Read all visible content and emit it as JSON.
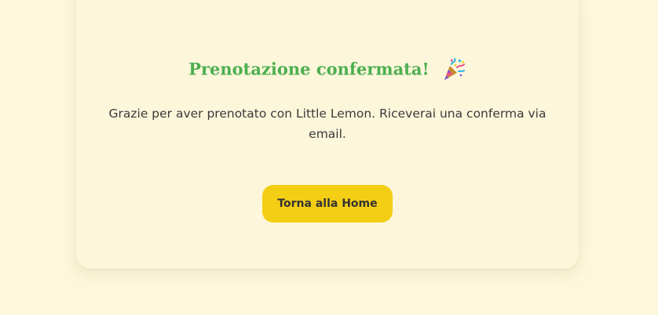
{
  "confirmation": {
    "title": "Prenotazione confermata!",
    "title_icon": "party-popper-icon",
    "message": "Grazie per aver prenotato con Little Lemon. Riceverai una conferma via email.",
    "home_button_label": "Torna alla Home"
  },
  "colors": {
    "page_background": "#fdf8dc",
    "card_background": "#fcf6da",
    "title_green": "#4caf50",
    "button_yellow": "#f4ce14",
    "text_dark": "#3a3a3a"
  }
}
